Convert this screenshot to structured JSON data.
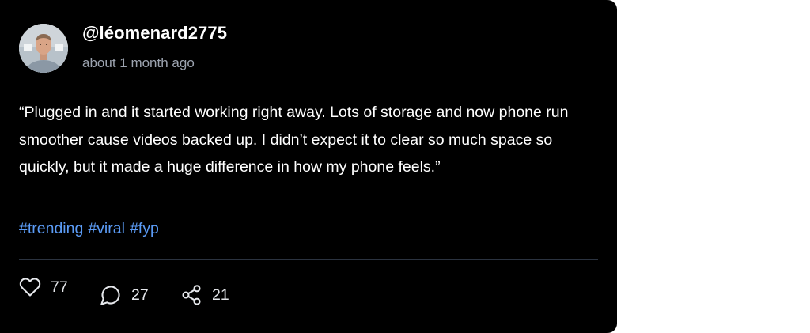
{
  "post": {
    "username": "@léomenard2775",
    "timestamp": "about 1 month ago",
    "text": "“Plugged in and it started working right away. Lots of storage and now phone run smoother cause videos backed up. I didn’t expect it to clear so much space so quickly, but it made a huge difference in how my phone feels.”",
    "hashtags": [
      "#trending",
      "#viral",
      "#fyp"
    ],
    "avatar_icon": "user-avatar-photo"
  },
  "actions": {
    "likes": "77",
    "comments": "27",
    "shares": "21",
    "like_icon": "heart-icon",
    "comment_icon": "speech-bubble-icon",
    "share_icon": "share-icon"
  },
  "colors": {
    "card_background": "#000000",
    "text": "#ffffff",
    "muted_text": "#9ca3af",
    "hashtag": "#5b9bf5",
    "divider": "#2b3340"
  }
}
